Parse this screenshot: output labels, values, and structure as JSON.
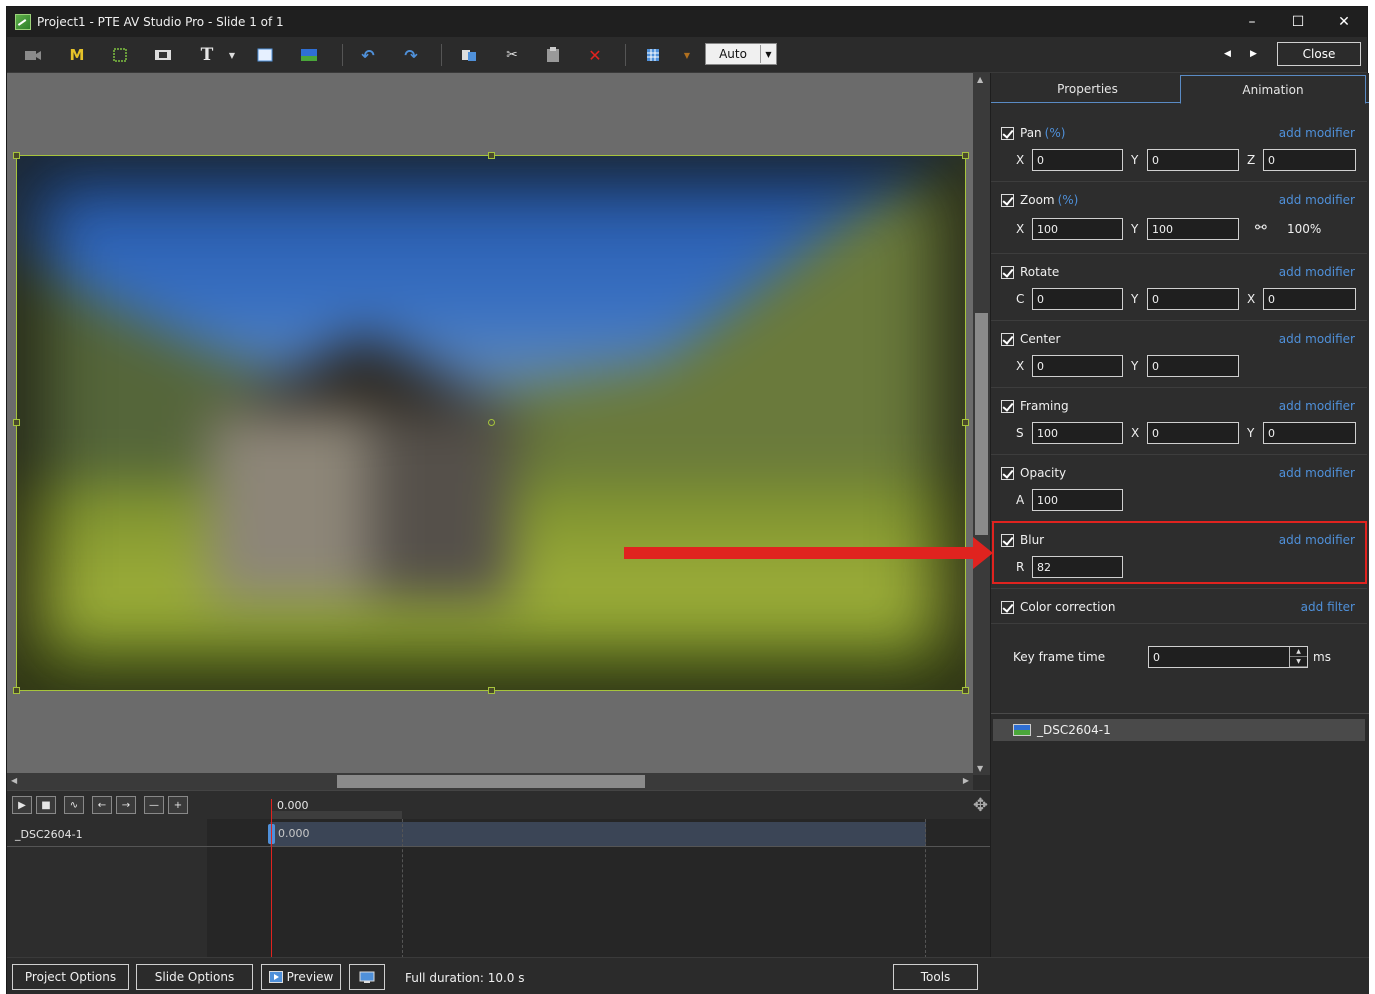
{
  "window": {
    "title": "Project1 - PTE AV Studio Pro - Slide 1 of 1",
    "controls": {
      "minimize": "–",
      "maximize": "☐",
      "close": "✕"
    }
  },
  "toolbar": {
    "text_tool_label": "T",
    "mask_label": "M",
    "zoom_select_value": "Auto",
    "close_label": "Close"
  },
  "tabs": [
    {
      "label": "Properties",
      "active": false
    },
    {
      "label": "Animation",
      "active": true
    }
  ],
  "animation": {
    "add_modifier": "add modifier",
    "add_filter": "add filter",
    "pan": {
      "label": "Pan",
      "unit": "(%)",
      "x_label": "X",
      "x": "0",
      "y_label": "Y",
      "y": "0",
      "z_label": "Z",
      "z": "0"
    },
    "zoom": {
      "label": "Zoom",
      "unit": "(%)",
      "x_label": "X",
      "x": "100",
      "y_label": "Y",
      "y": "100",
      "link_value": "100%"
    },
    "rotate": {
      "label": "Rotate",
      "c_label": "C",
      "c": "0",
      "y_label": "Y",
      "y": "0",
      "x_label": "X",
      "x": "0"
    },
    "center": {
      "label": "Center",
      "x_label": "X",
      "x": "0",
      "y_label": "Y",
      "y": "0"
    },
    "framing": {
      "label": "Framing",
      "s_label": "S",
      "s": "100",
      "x_label": "X",
      "x": "0",
      "y_label": "Y",
      "y": "0"
    },
    "opacity": {
      "label": "Opacity",
      "a_label": "A",
      "a": "100"
    },
    "blur": {
      "label": "Blur",
      "r_label": "R",
      "r": "82"
    },
    "color_correction": {
      "label": "Color correction"
    },
    "key_frame_time": {
      "label": "Key frame time",
      "value": "0",
      "unit": "ms"
    }
  },
  "objects": [
    {
      "name": "_DSC2604-1"
    }
  ],
  "timeline": {
    "ruler_time": "0.000",
    "track_name": "_DSC2604-1",
    "clip_time": "0.000",
    "buttons": [
      "▶",
      "■",
      "∿",
      "←",
      "→",
      "—",
      "+"
    ]
  },
  "bottombar": {
    "project_options": "Project Options",
    "slide_options": "Slide Options",
    "preview": "Preview",
    "full_duration": "Full duration: 10.0 s",
    "tools": "Tools"
  },
  "colors": {
    "accent_blue": "#4f90d9",
    "highlight_red": "#e0231f",
    "selection_green": "#a6c43c"
  }
}
